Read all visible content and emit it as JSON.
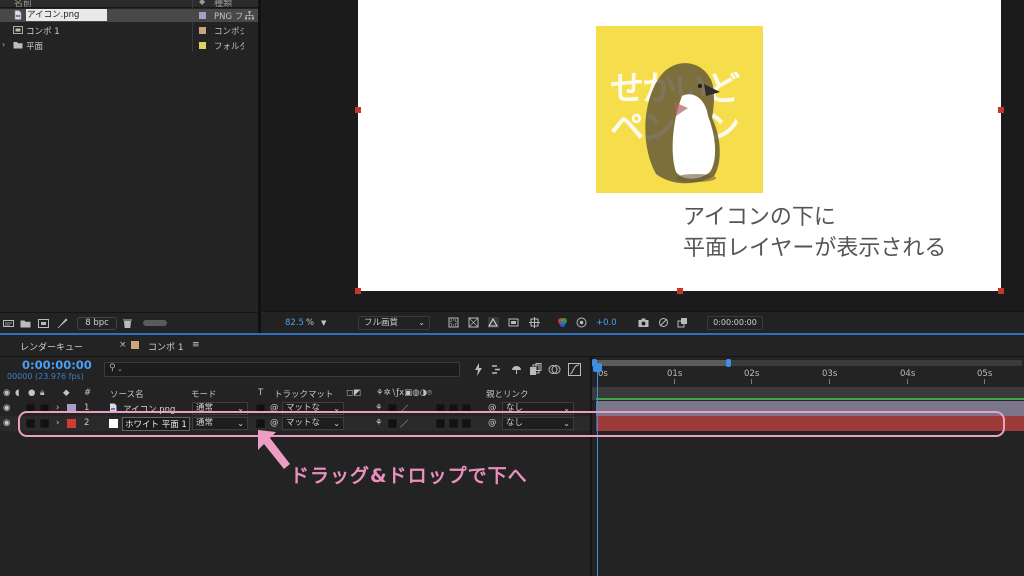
{
  "project": {
    "headers": {
      "name": "名前",
      "type": "種類"
    },
    "items": [
      {
        "name": "アイコン.png",
        "type": "PNG フ",
        "icon": "png-file-icon",
        "label_color": "#a69fc4"
      },
      {
        "name": "コンポ 1",
        "type": "コンポジ",
        "icon": "composition-icon",
        "label_color": "#c9a77d"
      },
      {
        "name": "平面",
        "type": "フォルダ",
        "icon": "folder-icon",
        "label_color": "#e0d160"
      }
    ],
    "footer": {
      "bpc": "8 bpc"
    }
  },
  "viewer": {
    "zoom": "82.5",
    "zoom_unit": "%",
    "resolution": "フル画質",
    "exposure": "+0.0",
    "time": "0:00:00:00",
    "artwork_text": [
      "せかいど",
      "ペンギン"
    ],
    "annotation_line1": "アイコンの下に",
    "annotation_line2": "平面レイヤーが表示される",
    "canvas_color": "#ffffff",
    "icon_bg": "#f6dd4b"
  },
  "timeline": {
    "tab_render": "レンダーキュー",
    "tab_comp": "コンポ 1",
    "timecode": "0:00:00:00",
    "fps": "00000 (23.976 fps)",
    "search_placeholder": "",
    "columns": {
      "hash": "#",
      "source": "ソース名",
      "mode": "モード",
      "t": "T",
      "matte": "トラックマット",
      "parent": "親とリンク"
    },
    "layers": [
      {
        "num": "1",
        "name": "アイコン.png",
        "mode": "通常",
        "matte": "マットな",
        "parent": "なし",
        "label_color": "#a69fc4"
      },
      {
        "num": "2",
        "name": "ホワイト 平面 1",
        "mode": "通常",
        "matte": "マットな",
        "parent": "なし",
        "label_color": "#d23a3a"
      }
    ],
    "ruler": [
      "0s",
      "01s",
      "02s",
      "03s",
      "04s",
      "05s"
    ]
  },
  "annotation": {
    "drag_drop": "ドラッグ&ドロップで下へ",
    "color": "#ec9ec4"
  }
}
